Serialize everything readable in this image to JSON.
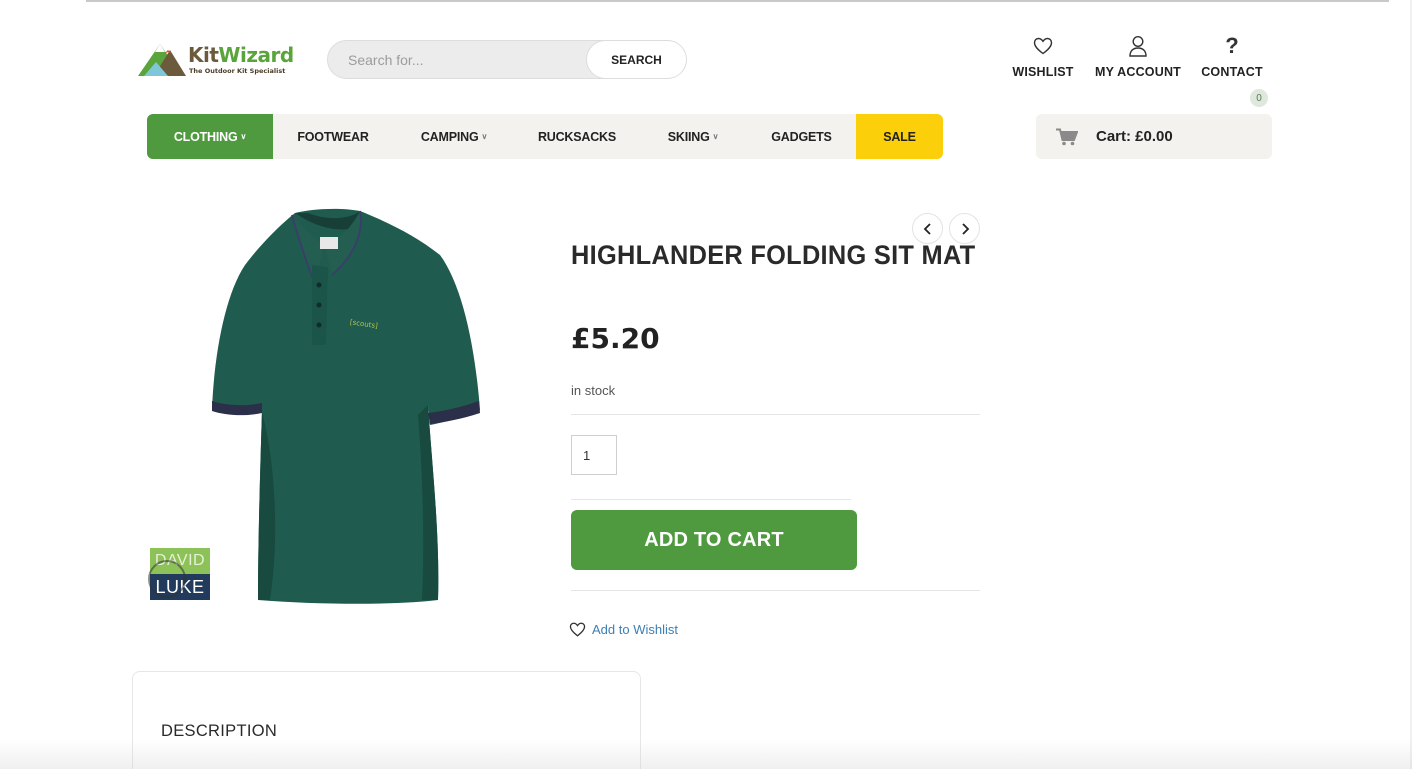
{
  "brand": {
    "name_part1": "Kit",
    "name_part2": "Wizard",
    "tagline": "The Outdoor Kit Specialist",
    "colors": {
      "green": "#4f9a3f",
      "brown": "#6b5a3c",
      "sale_yellow": "#fbcf09"
    }
  },
  "search": {
    "placeholder": "Search for...",
    "button_label": "SEARCH"
  },
  "header_links": {
    "wishlist": "WISHLIST",
    "account": "MY ACCOUNT",
    "contact": "CONTACT",
    "contact_icon": "?"
  },
  "cart": {
    "count": "0",
    "label": "Cart: £0.00"
  },
  "nav": {
    "items": [
      {
        "label": "CLOTHING",
        "has_dropdown": true,
        "active": true
      },
      {
        "label": "FOOTWEAR",
        "has_dropdown": false
      },
      {
        "label": "CAMPING",
        "has_dropdown": true
      },
      {
        "label": "RUCKSACKS",
        "has_dropdown": false
      },
      {
        "label": "SKIING",
        "has_dropdown": true
      },
      {
        "label": "GADGETS",
        "has_dropdown": false
      },
      {
        "label": "SALE",
        "has_dropdown": false,
        "highlight": true
      }
    ]
  },
  "product": {
    "title": "HIGHLANDER FOLDING SIT MAT",
    "price": "£5.20",
    "stock": "in stock",
    "quantity": "1",
    "add_to_cart": "ADD TO CART",
    "add_to_wishlist": "Add to Wishlist",
    "image_icon": "green-polo-shirt",
    "brand_badge": {
      "top": "DAVID",
      "bottom": "LUKE"
    }
  },
  "tabs": {
    "description": "DESCRIPTION"
  }
}
